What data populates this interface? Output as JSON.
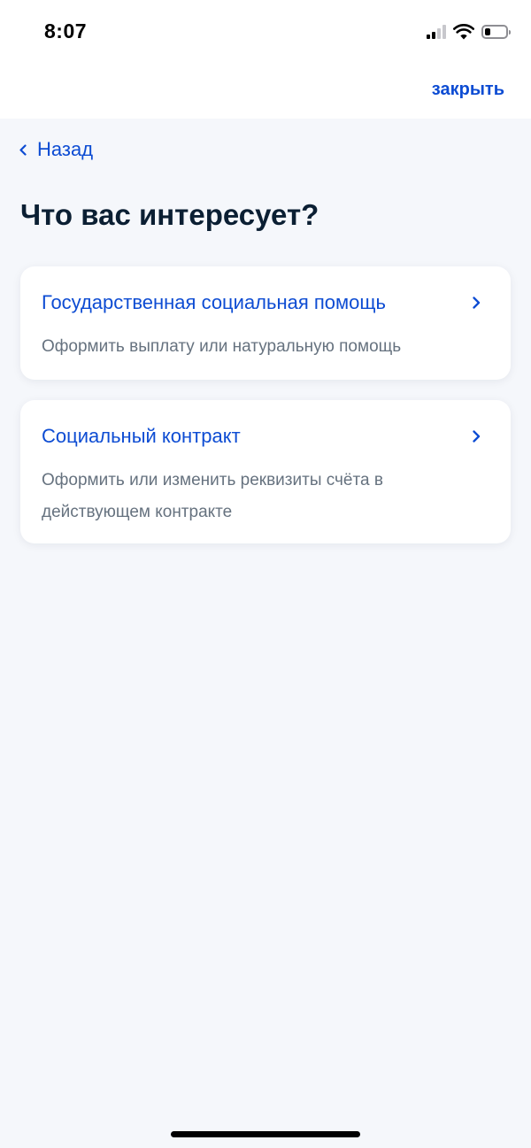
{
  "status_bar": {
    "time": "8:07",
    "icons": [
      "signal-icon",
      "wifi-icon",
      "battery-icon"
    ],
    "battery_level": 0.25
  },
  "header": {
    "close_label": "закрыть",
    "back_label": "Назад"
  },
  "page": {
    "title": "Что вас интересует?"
  },
  "options": [
    {
      "title": "Государственная социальная помощь",
      "description": "Оформить выплату или натуральную помощь"
    },
    {
      "title": "Социальный контракт",
      "description": "Оформить или изменить реквизиты счёта в действующем контракте"
    }
  ],
  "colors": {
    "accent": "#0d4cd3",
    "title": "#0b1f33",
    "muted": "#66727f",
    "background": "#f5f7fb",
    "card": "#ffffff"
  }
}
